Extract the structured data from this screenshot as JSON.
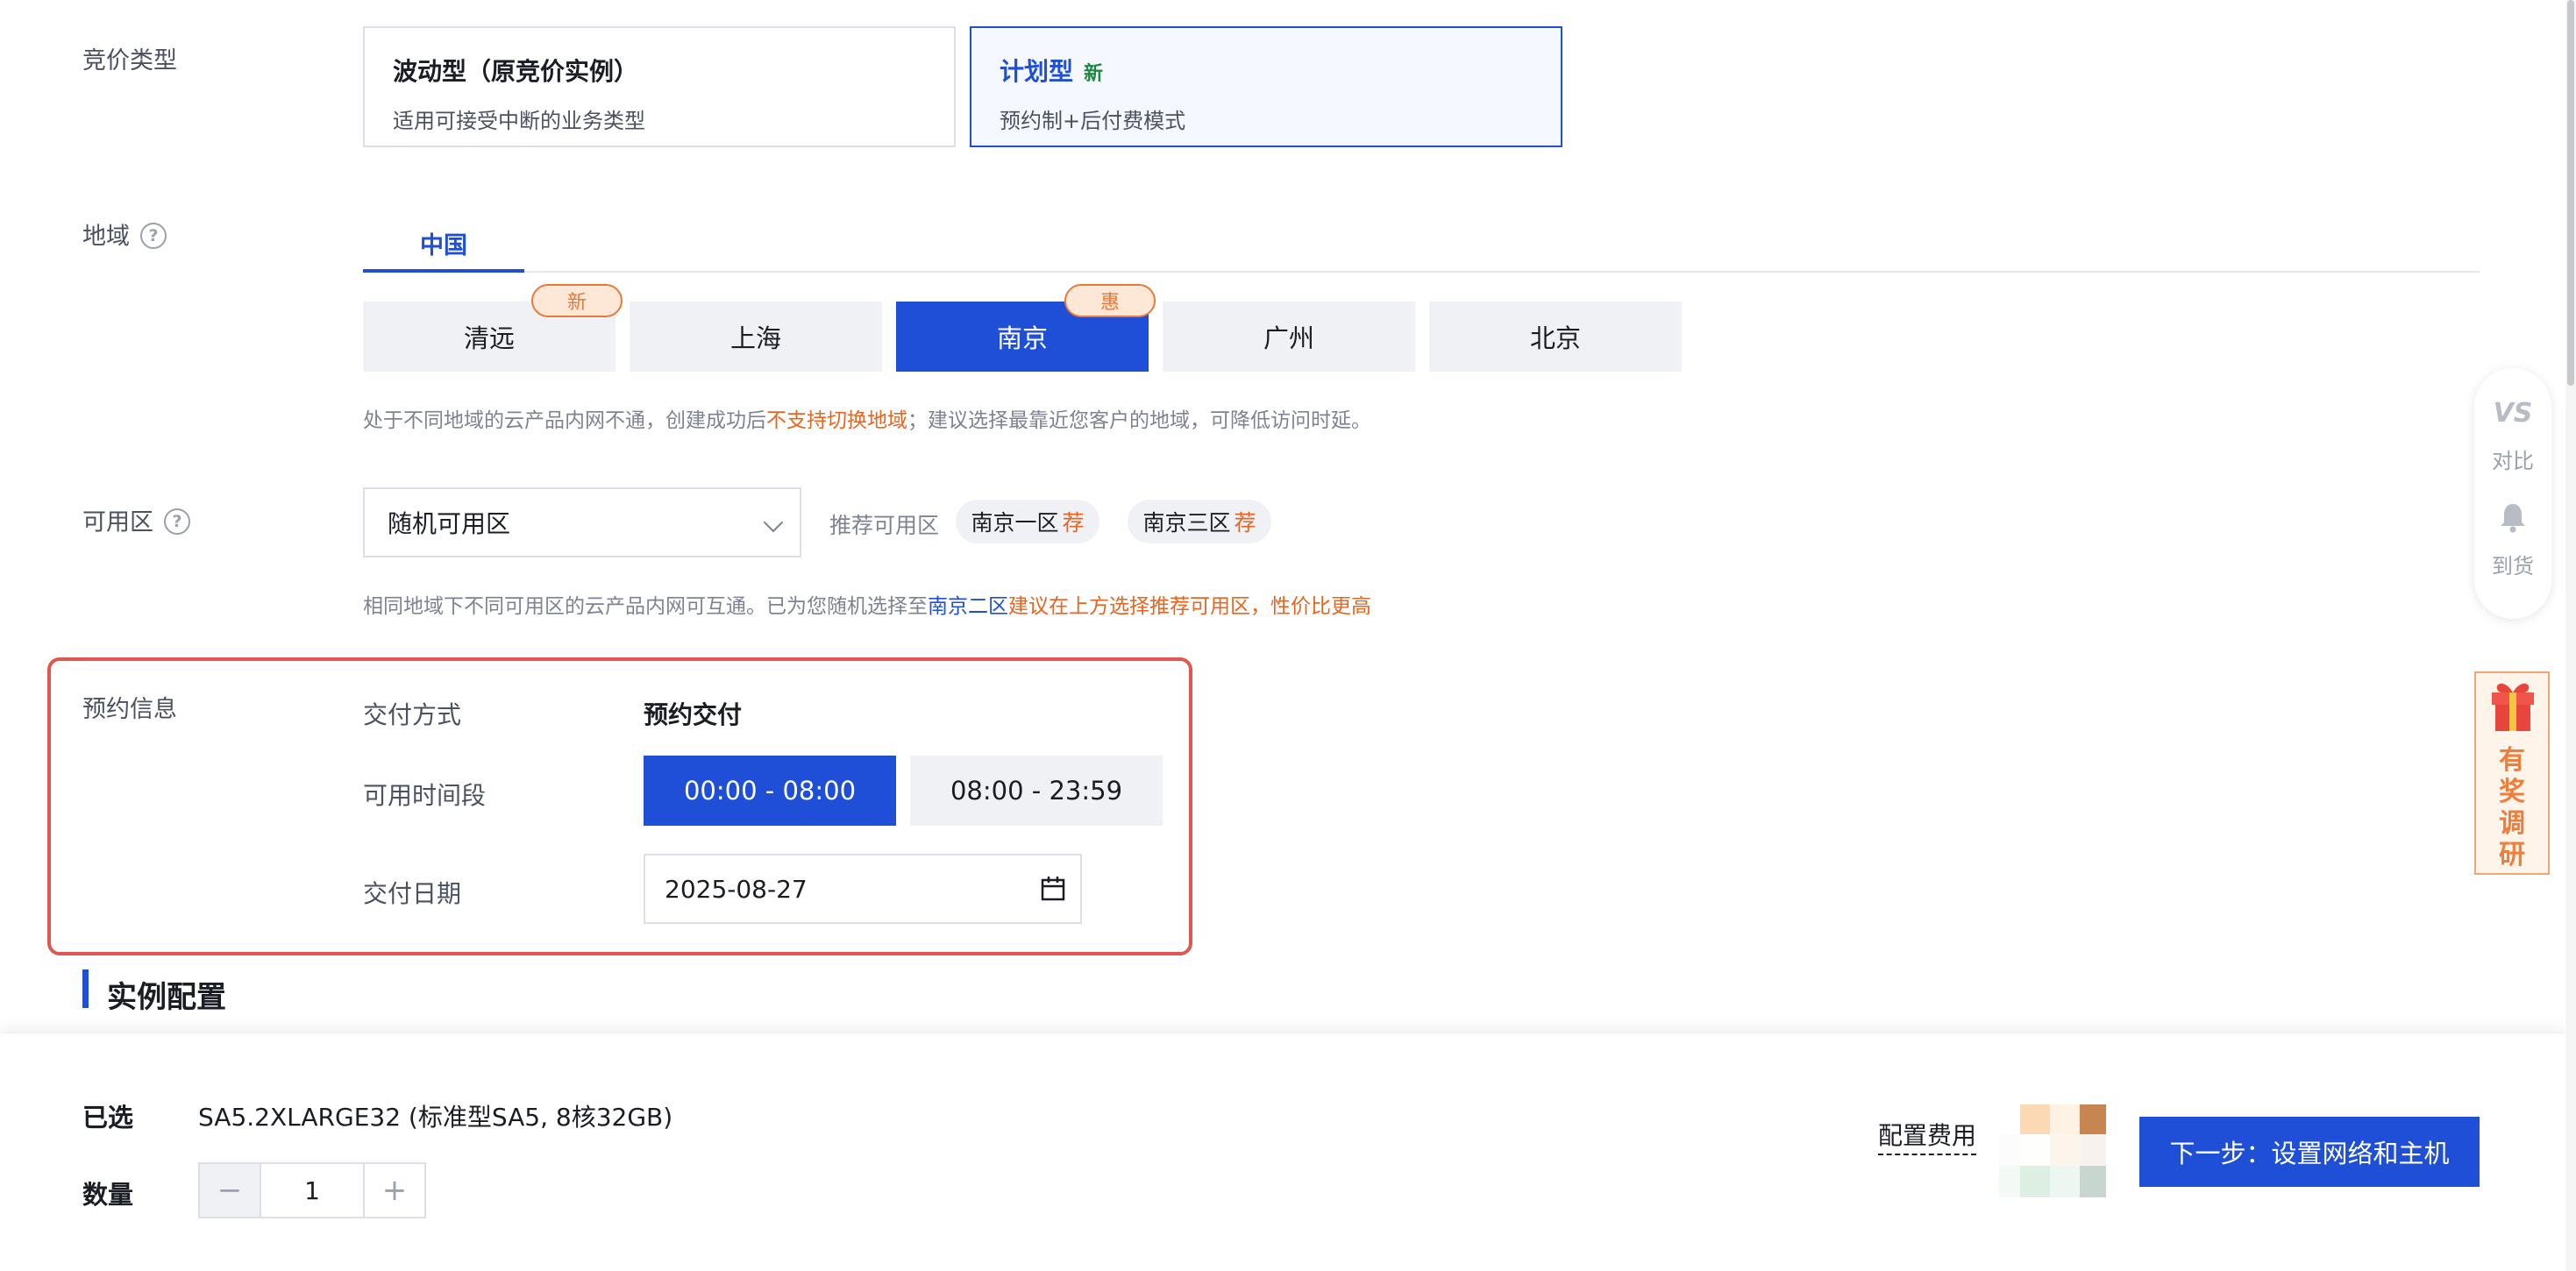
{
  "bid_type": {
    "label": "竞价类型",
    "options": [
      {
        "title": "波动型（原竞价实例）",
        "badge": "",
        "desc": "适用可接受中断的业务类型"
      },
      {
        "title": "计划型",
        "badge": "新",
        "desc": "预约制+后付费模式"
      }
    ],
    "selected": "计划型"
  },
  "region": {
    "label": "地域",
    "tab": "中国",
    "cities": [
      {
        "name": "清远",
        "tag": "新"
      },
      {
        "name": "上海",
        "tag": ""
      },
      {
        "name": "南京",
        "tag": "惠"
      },
      {
        "name": "广州",
        "tag": ""
      },
      {
        "name": "北京",
        "tag": ""
      }
    ],
    "selected": "南京",
    "hint_prefix": "处于不同地域的云产品内网不通，创建成功后",
    "hint_warn": "不支持切换地域",
    "hint_suffix": "；建议选择最靠近您客户的地域，可降低访问时延。"
  },
  "zone": {
    "label": "可用区",
    "select_value": "随机可用区",
    "recommend_label": "推荐可用区",
    "recommended": [
      {
        "name": "南京一区",
        "tag": "荐"
      },
      {
        "name": "南京三区",
        "tag": "荐"
      }
    ],
    "hint_prefix": "相同地域下不同可用区的云产品内网可互通。已为您随机选择至",
    "hint_link": "南京二区",
    "hint_warn": "建议在上方选择推荐可用区，性价比更高"
  },
  "reservation": {
    "label": "预约信息",
    "delivery_method_label": "交付方式",
    "delivery_method_value": "预约交付",
    "time_slot_label": "可用时间段",
    "time_slots": [
      "00:00 - 08:00",
      "08:00 - 23:59"
    ],
    "selected_slot": "00:00 - 08:00",
    "date_label": "交付日期",
    "date_value": "2025-08-27"
  },
  "instance_section": {
    "title": "实例配置"
  },
  "footer": {
    "selected_label": "已选",
    "selected_value": "SA5.2XLARGE32 (标准型SA5, 8核32GB)",
    "quantity_label": "数量",
    "quantity": "1",
    "minus": "−",
    "plus": "+",
    "fee_label": "配置费用",
    "next_button": "下一步：设置网络和主机"
  },
  "side": {
    "compare_icon": "VS",
    "compare": "对比",
    "notify": "到货",
    "survey": "有奖调研"
  },
  "colors": {
    "accent": "#1f4fd6",
    "warn": "#e8651f",
    "highlight_border": "#e0574f"
  }
}
